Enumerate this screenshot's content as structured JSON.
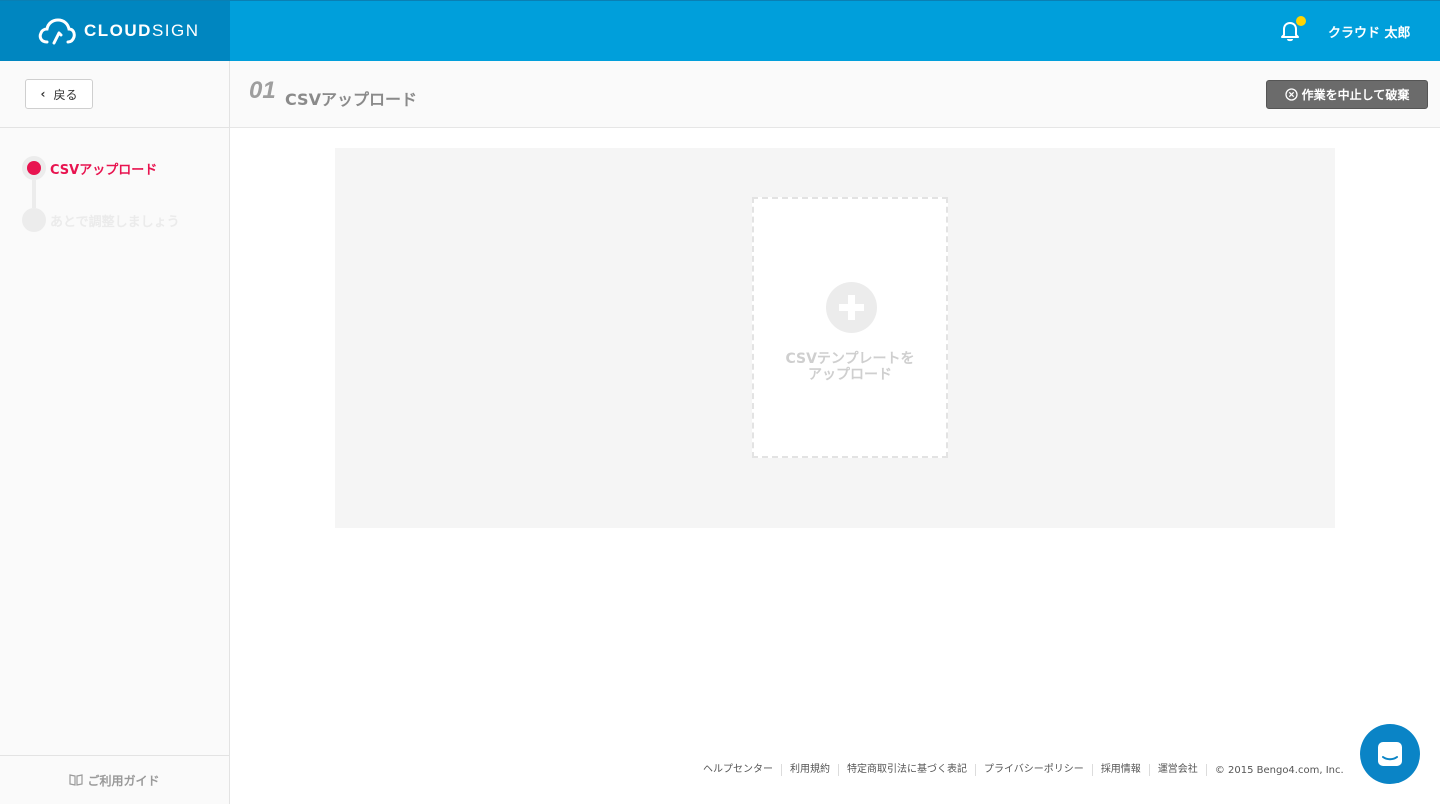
{
  "header": {
    "logo_text_bold": "CLOUD",
    "logo_text_light": "SIGN",
    "user_name": "クラウド 太郎",
    "notification_icon": "bell-icon",
    "colors": {
      "primary": "#009fdb",
      "logo_bg": "#0086c0",
      "notification_dot": "#ffd400"
    }
  },
  "sidebar": {
    "back_label": "戻る",
    "steps": [
      {
        "label": "CSVアップロード",
        "state": "active"
      },
      {
        "label": "あとで調整しましょう",
        "state": "inactive"
      }
    ],
    "guide_label": "ご利用ガイド",
    "colors": {
      "active_step": "#e8134f"
    }
  },
  "titlebar": {
    "step_number": "01",
    "title": "CSVアップロード",
    "abort_label": "作業を中止して破棄"
  },
  "main": {
    "dropzone_line1": "CSVテンプレートを",
    "dropzone_line2": "アップロード"
  },
  "footer": {
    "links": [
      "ヘルプセンター",
      "利用規約",
      "特定商取引法に基づく表記",
      "プライバシーポリシー",
      "採用情報",
      "運営会社"
    ],
    "copyright": "© 2015 Bengo4.com, Inc."
  },
  "chat": {
    "icon": "chat-icon"
  }
}
